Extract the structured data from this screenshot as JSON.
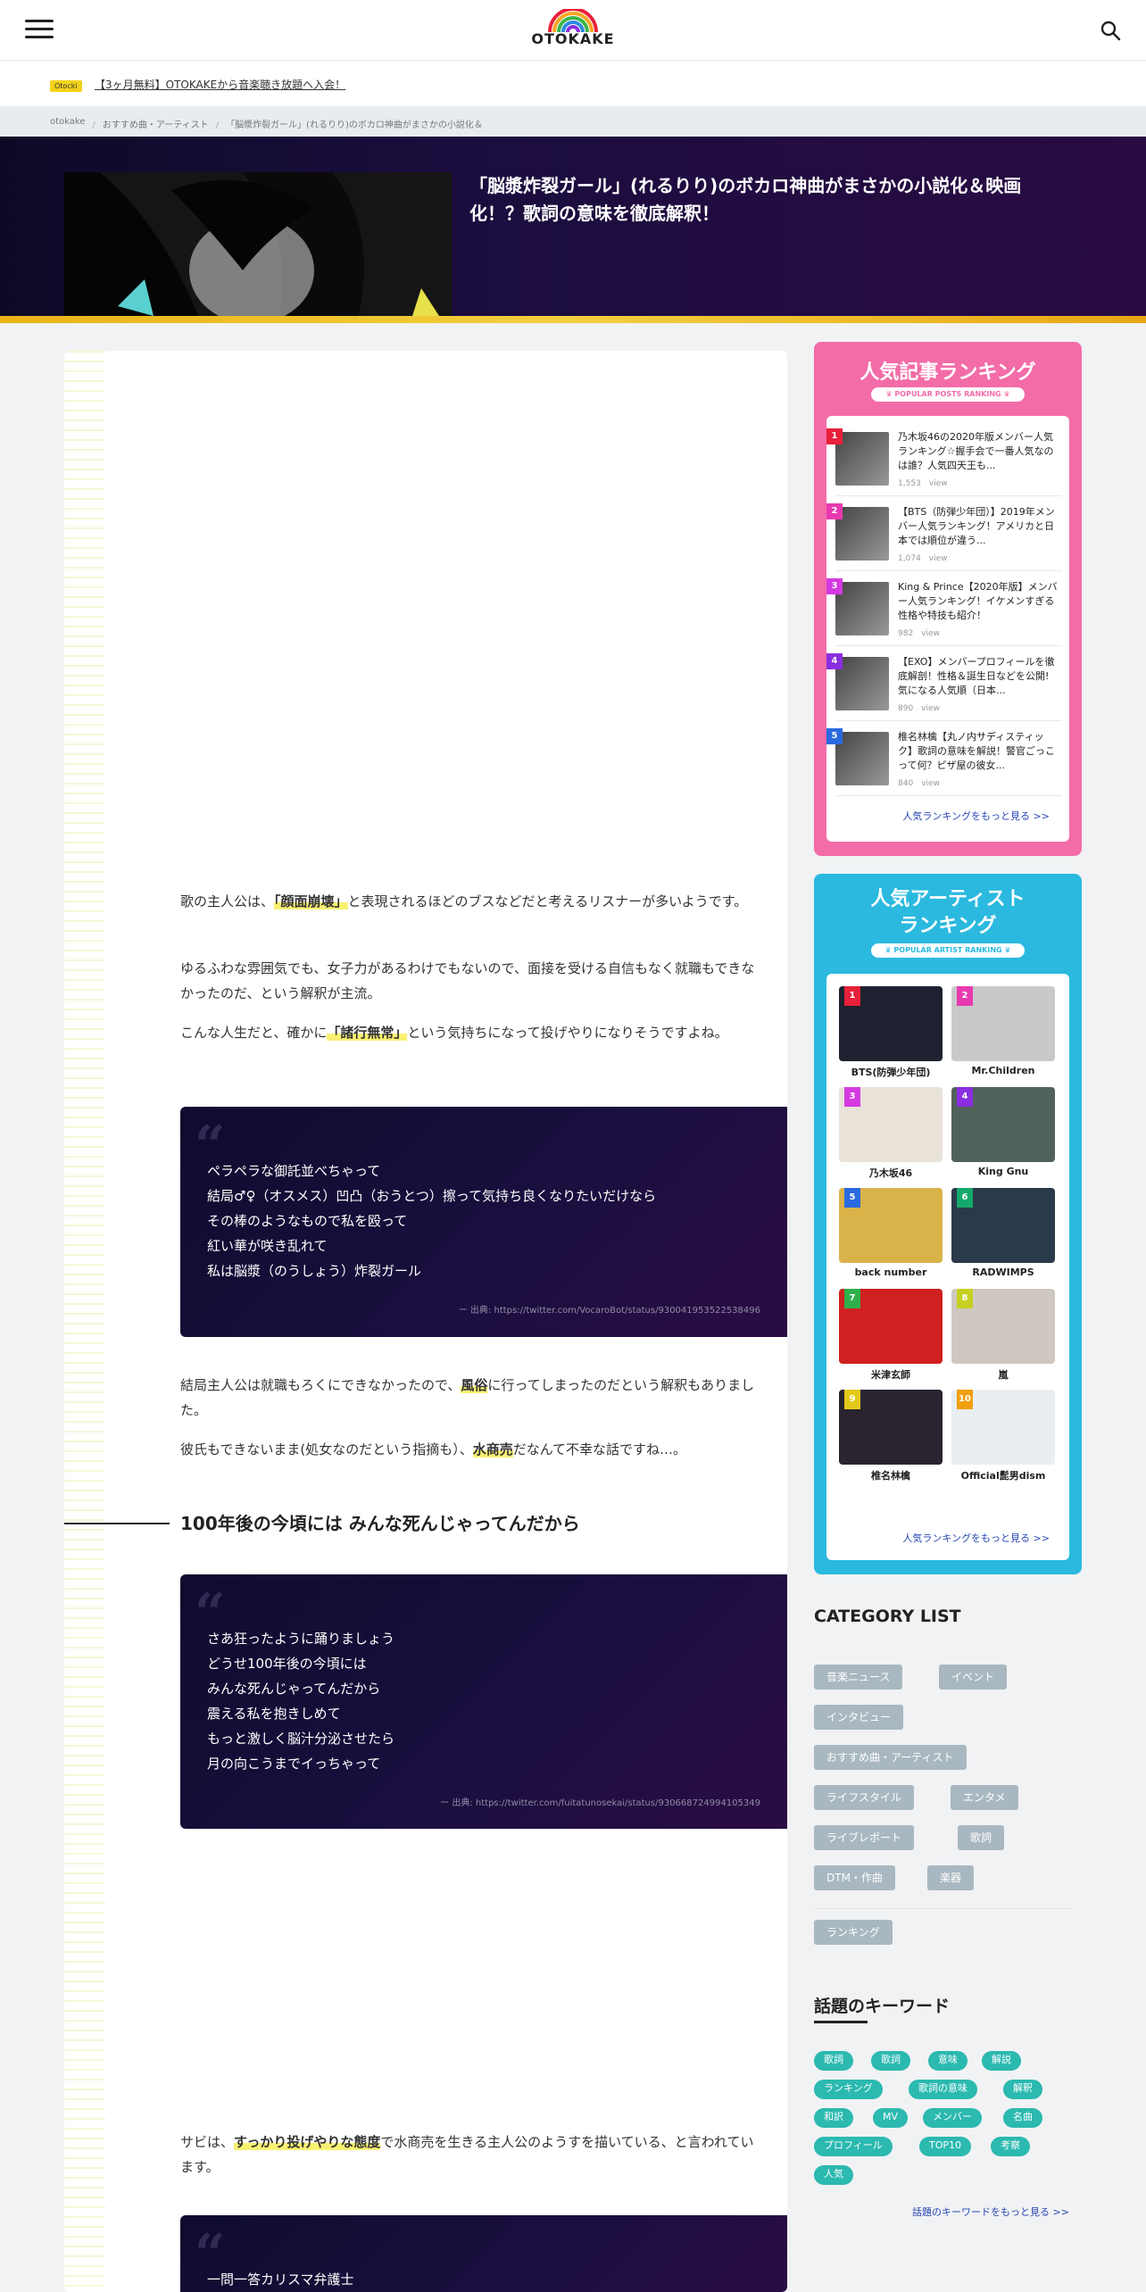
{
  "header": {
    "logo": "OTOKAKE"
  },
  "notice": {
    "badge": "Otocki",
    "text": "【3ヶ月無料】OTOKAKEから音楽聴き放題へ入会！"
  },
  "breadcrumb": [
    "otokake",
    "おすすめ曲・アーティスト",
    "「脳漿炸裂ガール」(れるりり)のボカロ神曲がまさかの小説化＆"
  ],
  "hero": {
    "title": "「脳漿炸裂ガール」(れるりり)のボカロ神曲がまさかの小説化＆映画化！？歌詞の意味を徹底解釈！"
  },
  "article": {
    "p1": {
      "a": "歌の主人公は、",
      "h": "「顔面崩壊」",
      "b": "と表現されるほどのブスなどだと考えるリスナーが多いようです。"
    },
    "p2": "ゆるふわな雰囲気でも、女子力があるわけでもないので、面接を受ける自信もなく就職もできなかったのだ、という解釈が主流。",
    "p3": {
      "a": "こんな人生だと、確かに",
      "h": "「諸行無常」",
      "b": "という気持ちになって投げやりになりそうですよね。"
    },
    "quote1": {
      "lines": [
        "ペラペラな御託並べちゃって",
        "結局♂♀（オスメス）凹凸（おうとつ）擦って気持ち良くなりたいだけなら",
        "その棒のようなもので私を殴って",
        "紅い華が咲き乱れて",
        "私は脳漿（のうしょう）炸裂ガール"
      ],
      "source": "ー 出典: https://twitter.com/VocaroBot/status/930041953522538496"
    },
    "p4": {
      "a": "結局主人公は就職もろくにできなかったので、",
      "h": "風俗",
      "b": "に行ってしまったのだという解釈もありました。"
    },
    "p5": {
      "a": "彼氏もできないまま(処女なのだという指摘も）、",
      "h": "水商売",
      "b": "だなんて不幸な話ですね…。"
    },
    "h2": "100年後の今頃には みんな死んじゃってんだから",
    "quote2": {
      "lines": [
        "さあ狂ったように踊りましょう",
        "どうせ100年後の今頃には",
        "みんな死んじゃってんだから",
        "震える私を抱きしめて",
        "もっと激しく脳汁分泌させたら",
        "月の向こうまでイっちゃって"
      ],
      "source": "ー 出典: https://twitter.com/fuitatunosekai/status/930668724994105349"
    },
    "p6": {
      "a": "サビは、",
      "h": "すっかり投げやりな態度",
      "b": "で水商売を生きる主人公のようすを描いている、と言われています。"
    },
    "quote3": {
      "lines": [
        "一問一答カリスマ弁護士"
      ]
    }
  },
  "ranking_posts": {
    "title": "人気記事ランキング",
    "sub": "♛ POPULAR POSTS RANKING ♛",
    "items": [
      {
        "num": "1",
        "title": "乃木坂46の2020年版メンバー人気ランキング☆握手会で一番人気なのは誰？人気四天王も...",
        "views": "1,553　view",
        "color": "#e8203a"
      },
      {
        "num": "2",
        "title": "【BTS（防弾少年団）】2019年メンバー人気ランキング！アメリカと日本では順位が違う...",
        "views": "1,074　view",
        "color": "#e83ab0"
      },
      {
        "num": "3",
        "title": "King & Prince【2020年版】メンバー人気ランキング！イケメンすぎる性格や特技も紹介！",
        "views": "982　view",
        "color": "#d43ae0"
      },
      {
        "num": "4",
        "title": "【EXO】メンバープロフィールを徹底解剖！性格＆誕生日などを公開!気になる人気順（日本...",
        "views": "890　view",
        "color": "#8a2ee0"
      },
      {
        "num": "5",
        "title": "椎名林檎【丸ノ内サディスティック】歌詞の意味を解説！警官ごっこって何？ピザ屋の彼女...",
        "views": "840　view",
        "color": "#2a6ae0"
      }
    ],
    "more": "人気ランキングをもっと見る >>"
  },
  "ranking_artists": {
    "title1": "人気アーティスト",
    "title2": "ランキング",
    "sub": "♛ POPULAR ARTIST RANKING ♛",
    "items": [
      {
        "num": "1",
        "name": "BTS(防弾少年団)",
        "color": "#e8203a",
        "bg": "#1e2230"
      },
      {
        "num": "2",
        "name": "Mr.Children",
        "color": "#e83ab0",
        "bg": "#c9c9c9"
      },
      {
        "num": "3",
        "name": "乃木坂46",
        "color": "#d43ae0",
        "bg": "#e9e2d8"
      },
      {
        "num": "4",
        "name": "King Gnu",
        "color": "#8a2ee0",
        "bg": "#51625a"
      },
      {
        "num": "5",
        "name": "back number",
        "color": "#2a6ae0",
        "bg": "#d9b34a"
      },
      {
        "num": "6",
        "name": "RADWIMPS",
        "color": "#14a86a",
        "bg": "#2a3a4a"
      },
      {
        "num": "7",
        "name": "米津玄師",
        "color": "#2eb04a",
        "bg": "#d02020"
      },
      {
        "num": "8",
        "name": "嵐",
        "color": "#c6d020",
        "bg": "#cfc8c0"
      },
      {
        "num": "9",
        "name": "椎名林檎",
        "color": "#e2c91a",
        "bg": "#2a2430"
      },
      {
        "num": "10",
        "name": "Official髭男dism",
        "color": "#f0a010",
        "bg": "#e9eef2"
      }
    ],
    "more": "人気ランキングをもっと見る >>"
  },
  "categories": {
    "title": "CATEGORY LIST",
    "items": [
      "音楽ニュース",
      "イベント",
      "インタビュー",
      "おすすめ曲・アーティスト",
      "ライフスタイル",
      "エンタメ",
      "ライブレポート",
      "歌詞",
      "DTM・作曲",
      "楽器",
      "ランキング"
    ]
  },
  "keywords": {
    "title": "話題のキーワード",
    "items": [
      "歌詞",
      "歌詞",
      "意味",
      "解説",
      "ランキング",
      "歌詞の意味",
      "解釈",
      "和訳",
      "MV",
      "メンバー",
      "名曲",
      "プロフィール",
      "TOP10",
      "考察",
      "人気"
    ],
    "more": "話題のキーワードをもっと見る >>"
  }
}
